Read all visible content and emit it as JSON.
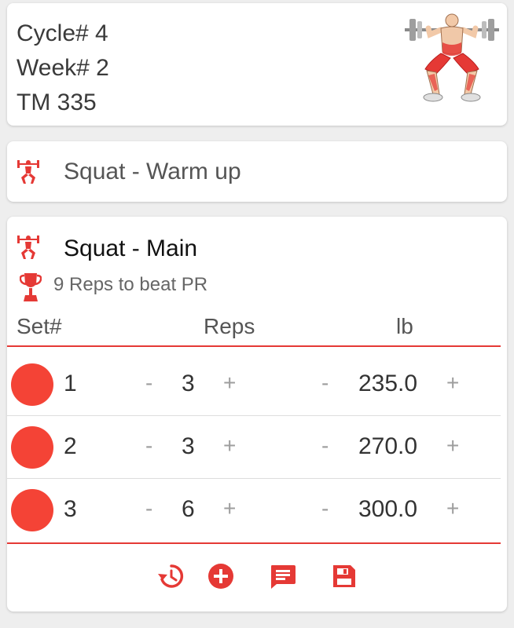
{
  "info": {
    "cycle": "Cycle# 4",
    "week": "Week# 2",
    "tm": "TM 335"
  },
  "warmup": {
    "title": "Squat - Warm up"
  },
  "main": {
    "title": "Squat - Main",
    "pr_text": "9 Reps to beat PR",
    "headers": {
      "set": "Set#",
      "reps": "Reps",
      "lb": "lb"
    },
    "rows": [
      {
        "set": "1",
        "reps": "3",
        "weight": "235.0"
      },
      {
        "set": "2",
        "reps": "3",
        "weight": "270.0"
      },
      {
        "set": "3",
        "reps": "6",
        "weight": "300.0"
      }
    ],
    "minus": "-",
    "plus": "+"
  },
  "colors": {
    "accent": "#e53935",
    "set_dot": "#f44336"
  },
  "icons": {
    "exercise": "squat-figure-icon",
    "pr": "trophy-icon",
    "actions": [
      "history-icon",
      "add-circle-icon",
      "comment-icon",
      "save-icon"
    ]
  }
}
